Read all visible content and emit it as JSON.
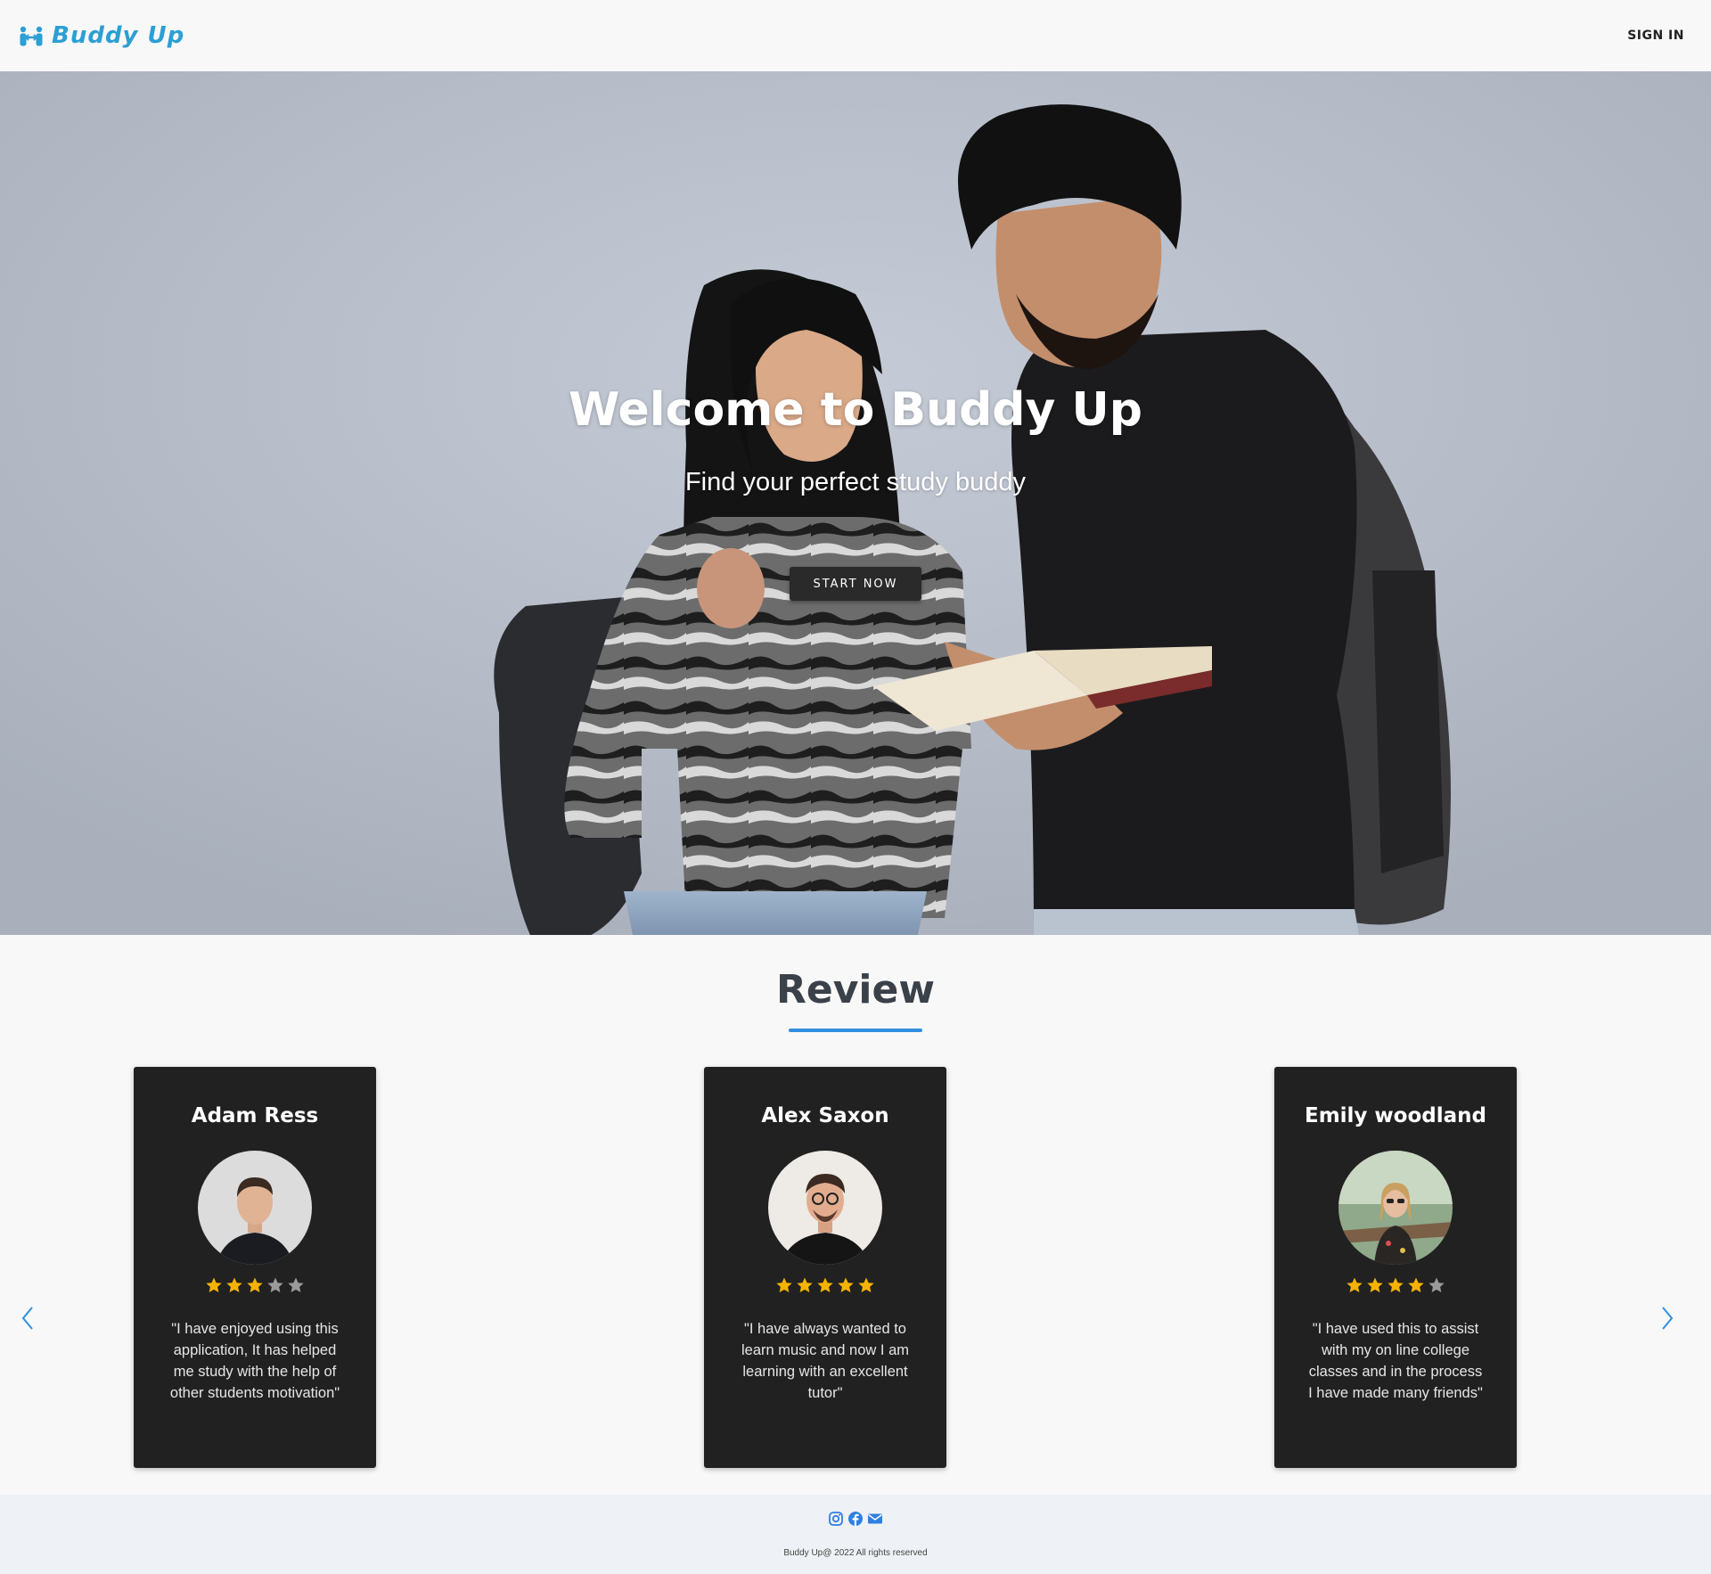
{
  "header": {
    "logo_text": "Buddy Up",
    "signin_label": "SIGN IN",
    "brand_color": "#2c9fd3"
  },
  "hero": {
    "title": "Welcome to Buddy Up",
    "subtitle": "Find your perfect study buddy",
    "cta_label": "START NOW",
    "image": "photo-two-students-reading-book"
  },
  "review": {
    "title": "Review",
    "accent_color": "#2f8fe0",
    "prev_icon": "chevron-left-icon",
    "next_icon": "chevron-right-icon",
    "cards": [
      {
        "name": "Adam Ress",
        "rating": 3,
        "max_rating": 5,
        "quote": "\"I have enjoyed using this application, It has helped me study with the help of other students motivation\""
      },
      {
        "name": "Alex Saxon",
        "rating": 5,
        "max_rating": 5,
        "quote": "\"I have always wanted to learn music and now I am learning with an excellent tutor\""
      },
      {
        "name": "Emily woodland",
        "rating": 4,
        "max_rating": 5,
        "quote": "\"I have used this to assist with my on line college classes and in the process I have made many friends\""
      }
    ],
    "star_color_filled": "#f5b301",
    "star_color_empty": "#9a9a9a"
  },
  "footer": {
    "social_icons": [
      "instagram-icon",
      "facebook-icon",
      "envelope-icon"
    ],
    "copyright": "Buddy Up@ 2022 All rights reserved"
  }
}
